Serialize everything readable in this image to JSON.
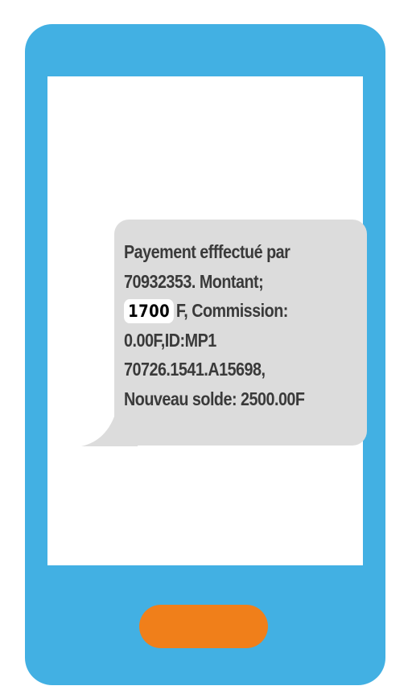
{
  "message": {
    "line1": "Payement efffectué par",
    "line2": "70932353. Montant;",
    "amount": "1700",
    "line3_rest": "F, Commission:",
    "line4": "0.00F,ID:MP1",
    "line5": "70726.1541.A15698,",
    "line6": "Nouveau solde: 2500.00F"
  },
  "colors": {
    "phone_body": "#42b0e3",
    "screen": "#ffffff",
    "bubble": "#dcdcdc",
    "home_button": "#f07f1a",
    "text": "#3a3a3a"
  },
  "icons": {
    "home_button": "home-button"
  }
}
